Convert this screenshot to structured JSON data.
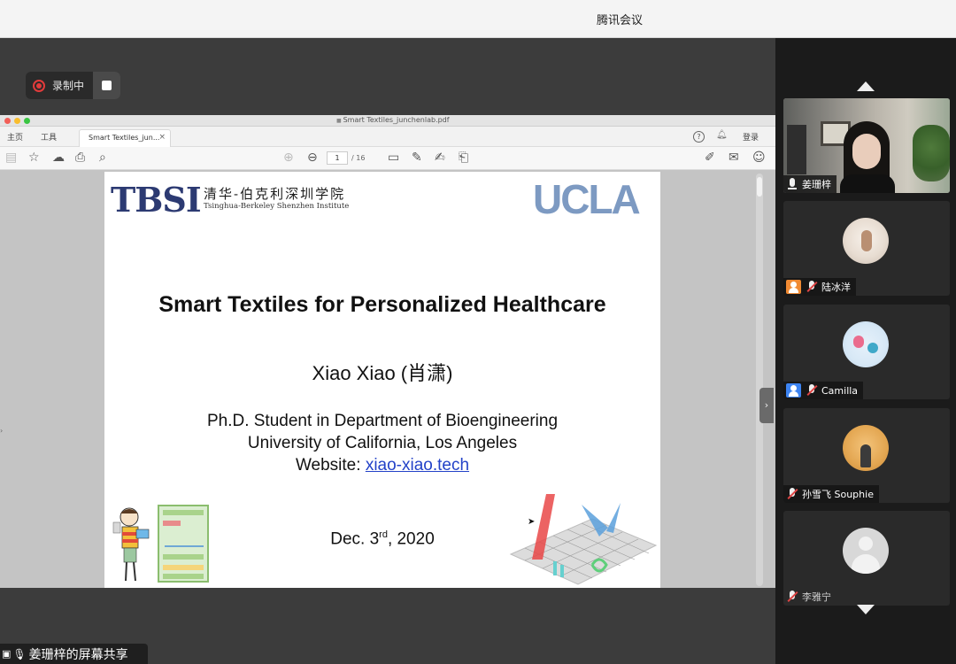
{
  "app": {
    "title": "腾讯会议"
  },
  "recording": {
    "label": "录制中"
  },
  "pdf_viewer": {
    "filename": "Smart Textiles_junchenlab.pdf",
    "tabs": {
      "home": "主页",
      "tools": "工具",
      "document": "Smart Textiles_jun...",
      "close": "×"
    },
    "login": "登录",
    "page": {
      "current": "1",
      "total": "/ 16"
    },
    "icons": [
      "save-icon",
      "star-icon",
      "upload-icon",
      "print-icon",
      "zoom-icon",
      "page-up-icon",
      "page-down-icon",
      "comment-icon",
      "pen-icon",
      "sign-icon",
      "stamp-icon",
      "share-link-icon",
      "mail-icon",
      "add-user-icon"
    ]
  },
  "slide": {
    "logo_tbsi": "TBSI",
    "tbsi_cn": "清华-伯克利深圳学院",
    "tbsi_en": "Tsinghua-Berkeley Shenzhen Institute",
    "logo_ucla": "UCLA",
    "title": "Smart Textiles for Personalized Healthcare",
    "presenter": "Xiao Xiao (肖潇)",
    "affiliation_line1": "Ph.D. Student in Department of Bioengineering",
    "affiliation_line2": "University of California, Los Angeles",
    "website_prefix": "Website: ",
    "website_link": "xiao-xiao.tech",
    "date_pre": "Dec. 3",
    "date_sup": "rd",
    "date_post": ", 2020"
  },
  "share_banner": {
    "text": "姜珊梓的屏幕共享"
  },
  "participants": [
    {
      "name": "姜珊梓",
      "mic": "on",
      "video": true
    },
    {
      "name": "陆冰洋",
      "mic": "muted",
      "badge": "host",
      "badge_color": "#f08a33"
    },
    {
      "name": "Camilla",
      "mic": "muted",
      "badge": "cohost",
      "badge_color": "#3d84f2"
    },
    {
      "name": "孙雪飞 Souphie",
      "mic": "muted"
    },
    {
      "name": "李雅宁",
      "mic": "muted"
    }
  ]
}
